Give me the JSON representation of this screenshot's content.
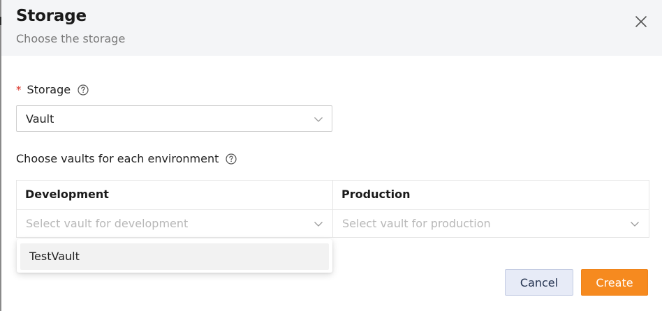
{
  "dialog": {
    "title": "Storage",
    "subtitle": "Choose the storage"
  },
  "storage_field": {
    "required_mark": "*",
    "label": "Storage",
    "selected_value": "Vault"
  },
  "environments": {
    "label": "Choose vaults for each environment",
    "columns": [
      {
        "header": "Development",
        "placeholder": "Select vault for development"
      },
      {
        "header": "Production",
        "placeholder": "Select vault for production"
      }
    ]
  },
  "dropdown": {
    "options": [
      "TestVault"
    ]
  },
  "footer": {
    "cancel_label": "Cancel",
    "create_label": "Create"
  },
  "colors": {
    "accent": "#f68a1f",
    "header_bg": "#f4f5f7",
    "required": "#d93025",
    "cancel_bg": "#e7ebf7"
  },
  "icons": [
    "close-icon",
    "help-icon",
    "chevron-down-icon"
  ]
}
